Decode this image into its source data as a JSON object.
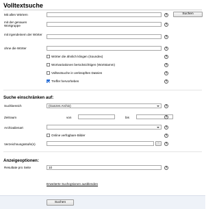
{
  "title": "Volltextsuche",
  "search": {
    "labels": [
      "Mit allen Wörtern",
      "mit der genauen Wortgruppe",
      "mit irgendeinem der Wörter",
      "ohne die Wörter"
    ],
    "values": [
      "",
      "",
      "",
      ""
    ],
    "search_button": "Suchen",
    "options": [
      {
        "label": "Wörter die ähnlich klingen (Soundex)",
        "checked": false
      },
      {
        "label": "Wortvariationen berücksichtigen (Wortstamm)",
        "checked": false
      },
      {
        "label": "Volltextsuche in verknüpften Dateien",
        "checked": false
      },
      {
        "label": "Treffer hervorheben",
        "checked": true
      }
    ]
  },
  "restrict": {
    "heading": "Suche einschränken auf:",
    "scope_label": "Suchbereich",
    "scope_value": "(Ganzes Archiv)",
    "period_label": "Zeitraum",
    "from_label": "von",
    "to_label": "bis",
    "from_value": "",
    "to_value": "",
    "archive_type_label": "Archivalienart",
    "archive_type_value": "",
    "online_images_label": "Online verfügbare Bilder",
    "online_images_checked": false,
    "level_label": "Verzeichnungsstufe(n)",
    "level_value": "",
    "browse_label": "..."
  },
  "display": {
    "heading": "Anzeigeoptionen:",
    "results_label": "Resultate pro Seite",
    "results_value": "10",
    "advanced_link": "Erweiterte Suchoptionen ausblenden"
  },
  "footer": {
    "search_button": "Suchen"
  },
  "help_glyph": "?"
}
